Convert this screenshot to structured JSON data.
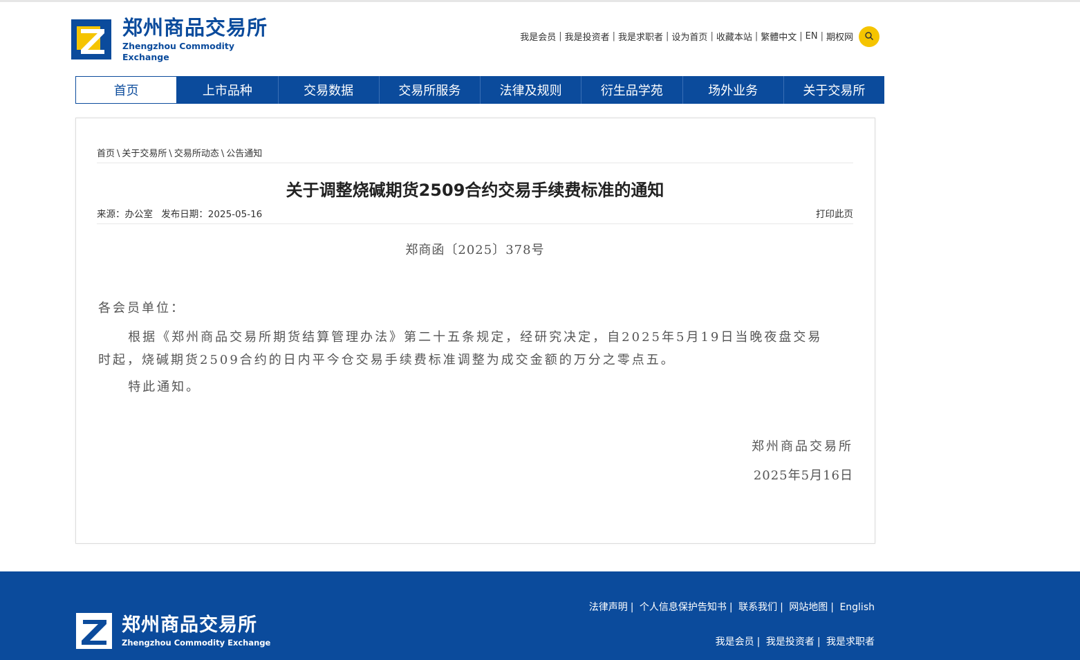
{
  "header": {
    "logo_cn": "郑州商品交易所",
    "logo_en": "Zhengzhou Commodity Exchange",
    "links": [
      "我是会员",
      "我是投资者",
      "我是求职者",
      "设为首页",
      "收藏本站",
      "繁體中文",
      "EN",
      "期权网"
    ]
  },
  "nav": {
    "items": [
      "首页",
      "上市品种",
      "交易数据",
      "交易所服务",
      "法律及规则",
      "衍生品学苑",
      "场外业务",
      "关于交易所"
    ]
  },
  "breadcrumb": [
    "首页",
    "关于交易所",
    "交易所动态",
    "公告通知"
  ],
  "article": {
    "title": "关于调整烧碱期货2509合约交易手续费标准的通知",
    "source": "来源：办公室",
    "date": "发布日期：2025-05-16",
    "print": "打印此页",
    "doc_no": "郑商函〔2025〕378号",
    "salutation": "各会员单位：",
    "paragraph": "根据《郑州商品交易所期货结算管理办法》第二十五条规定，经研究决定，自2025年5月19日当晚夜盘交易时起，烧碱期货2509合约的日内平今仓交易手续费标准调整为成交金额的万分之零点五。",
    "closing": "特此通知。",
    "sign_org": "郑州商品交易所",
    "sign_date": "2025年5月16日"
  },
  "footer": {
    "logo_cn": "郑州商品交易所",
    "logo_en": "Zhengzhou Commodity Exchange",
    "links_row1": [
      "法律声明",
      "个人信息保护告知书",
      "联系我们",
      "网站地图",
      "English"
    ],
    "links_row2": [
      "我是会员",
      "我是投资者",
      "我是求职者"
    ]
  },
  "colors": {
    "brand_blue": "#0b4b9c",
    "accent_yellow": "#f5c400"
  }
}
